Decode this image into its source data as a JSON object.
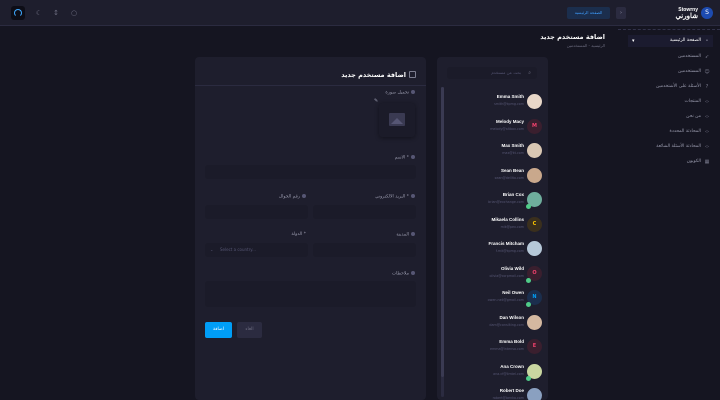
{
  "header": {
    "home_button": "الصفحة الرئيسية",
    "user_name": "Stowrny",
    "user_subtitle": "شاورني",
    "user_initial": "S"
  },
  "sidebar": {
    "items": [
      {
        "label": "الصفحة الرئيسية",
        "icon": "home-icon"
      },
      {
        "label": "المستخدمين",
        "icon": "rocket-icon"
      },
      {
        "label": "المستخدمين",
        "icon": "users-icon"
      },
      {
        "label": "الأسئلة على الأشتخدمين",
        "icon": "question-icon"
      },
      {
        "label": "المنتجات",
        "icon": "code-icon"
      },
      {
        "label": "من نحن",
        "icon": "code-icon"
      },
      {
        "label": "المحادثة المحددة",
        "icon": "code-icon"
      },
      {
        "label": "المحادثة الأسئلة الشائعة",
        "icon": "code-icon"
      },
      {
        "label": "الكوبون",
        "icon": "grid-icon"
      }
    ]
  },
  "page": {
    "title": "اضافة مستخدم جديد",
    "breadcrumb": "الرئيسية - المستخدمين"
  },
  "list": {
    "search_placeholder": "بحث عن مستخدم",
    "users": [
      {
        "name": "Emma Smith",
        "email": "smith@kpmg.com",
        "initial": "",
        "avatar_bg": "#e8d7c8",
        "avatar_fg": "#3a2a20",
        "online": false
      },
      {
        "name": "Melody Macy",
        "email": "melody@altbox.com",
        "initial": "M",
        "avatar_bg": "#3a1f2e",
        "avatar_fg": "#f1416c",
        "online": false
      },
      {
        "name": "Max Smith",
        "email": "max@kt.com",
        "initial": "",
        "avatar_bg": "#d9c7b3",
        "avatar_fg": "#3a2a20",
        "online": false
      },
      {
        "name": "Sean Bean",
        "email": "sean@dellito.com",
        "initial": "",
        "avatar_bg": "#c9a88c",
        "avatar_fg": "#3a2a20",
        "online": false
      },
      {
        "name": "Brian Cox",
        "email": "brian@exchange.com",
        "initial": "",
        "avatar_bg": "#6fae9d",
        "avatar_fg": "#1b3a33",
        "online": true
      },
      {
        "name": "Mikaela Collins",
        "email": "mik@pex.com",
        "initial": "C",
        "avatar_bg": "#3a2f1d",
        "avatar_fg": "#ffc700",
        "online": false
      },
      {
        "name": "Francis Mitcham",
        "email": "f.mit@kpmg.com",
        "initial": "",
        "avatar_bg": "#b6c8d8",
        "avatar_fg": "#1b2a3a",
        "online": false
      },
      {
        "name": "Olivia Wild",
        "email": "olivia@corpmail.com",
        "initial": "O",
        "avatar_bg": "#3a1f2e",
        "avatar_fg": "#f1416c",
        "online": true
      },
      {
        "name": "Neil Owen",
        "email": "owen.neil@gmail.com",
        "initial": "N",
        "avatar_bg": "#1b2e4d",
        "avatar_fg": "#009ef7",
        "online": true
      },
      {
        "name": "Dan Wilson",
        "email": "dam@consilting.com",
        "initial": "",
        "avatar_bg": "#d4b8a0",
        "avatar_fg": "#3a2a20",
        "online": false
      },
      {
        "name": "Emma Bold",
        "email": "emma@intenso.com",
        "initial": "E",
        "avatar_bg": "#3a1f2e",
        "avatar_fg": "#f1416c",
        "online": false
      },
      {
        "name": "Ana Crown",
        "email": "ana.cf@limtel.com",
        "initial": "",
        "avatar_bg": "#c9d6a0",
        "avatar_fg": "#2a3a1b",
        "online": true
      },
      {
        "name": "Robert Doe",
        "email": "robert@benko.com",
        "initial": "",
        "avatar_bg": "#8aa0c0",
        "avatar_fg": "#1b2a3a",
        "online": false
      }
    ]
  },
  "form": {
    "title": "اضافة مستخدم جديد",
    "image_label": "تحميل صورة",
    "name_label": "الاسم *",
    "email_label": "البريد الالكتروني *",
    "phone_label": "رقم الجوال",
    "city_label": "المدينة",
    "country_label": "الدولة *",
    "country_placeholder": "Select a country...",
    "notes_label": "ملاحظات",
    "add_button": "اضافة",
    "cancel_button": "الغاء"
  },
  "colors": {
    "background": "#151521",
    "panel": "#1e1e2d",
    "primary": "#009ef7"
  }
}
